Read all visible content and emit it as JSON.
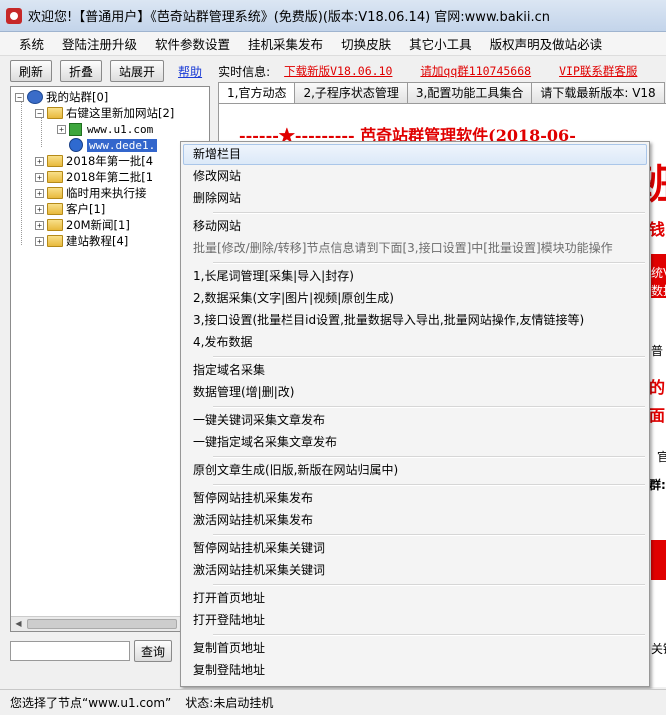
{
  "window": {
    "title": "欢迎您!【普通用户】《芭奇站群管理系统》(免费版)(版本:V18.06.14) 官网:www.bakii.cn"
  },
  "menubar": {
    "items": [
      "系统",
      "登陆注册升级",
      "软件参数设置",
      "挂机采集发布",
      "切换皮肤",
      "其它小工具",
      "版权声明及做站必读"
    ]
  },
  "toolbar": {
    "refresh_label": "刷新",
    "collapse_label": "折叠",
    "expand_label": "站展开",
    "help_label": "帮助",
    "realtime_label": "实时信息:",
    "download_link": "下载新版V18.06.10",
    "qq_link": "请加qq群110745668",
    "vip_link": "VIP联系群客服"
  },
  "tree": {
    "root_label": "我的站群[0]",
    "group_label": "右键这里新加网站[2]",
    "site1_label": "www.u1.com",
    "site2_label": "www.dede1.",
    "batch1_label": "2018年第一批[4",
    "batch2_label": "2018年第二批[1",
    "temp_label": "临时用来执行接",
    "client_label": "客户[1]",
    "news_label": "20M新闻[1]",
    "tutorial_label": "建站教程[4]"
  },
  "search": {
    "value": "",
    "query_label": "查询"
  },
  "tabs": [
    "1,官方动态",
    "2,子程序状态管理",
    "3,配置功能工具集合",
    "请下载最新版本: V18"
  ],
  "content": {
    "banner": "------★--------- 芭奇站群管理软件(2018-06-",
    "big_char": "班",
    "fragment_1": "钱,",
    "fragment_2": "统V",
    "fragment_3": "数据",
    "fragment_4": "普",
    "fragment_5": "的",
    "fragment_6": "面",
    "fragment_7": "官",
    "fragment_8": "群:",
    "fragment_9": "关键"
  },
  "context_menu": {
    "items": [
      {
        "label": "新增栏目",
        "state": "hover"
      },
      {
        "label": "修改网站",
        "state": "normal"
      },
      {
        "label": "删除网站",
        "state": "normal"
      },
      {
        "label": "移动网站",
        "state": "normal"
      },
      {
        "label": "批量[修改/删除/转移]节点信息请到下面[3,接口设置]中[批量设置]模块功能操作",
        "state": "disabled"
      },
      {
        "label": "1,长尾词管理[采集|导入|封存)",
        "state": "normal"
      },
      {
        "label": "2,数据采集(文字|图片|视频|原创生成)",
        "state": "normal"
      },
      {
        "label": "3,接口设置(批量栏目id设置,批量数据导入导出,批量网站操作,友情链接等)",
        "state": "normal"
      },
      {
        "label": "4,发布数据",
        "state": "normal"
      },
      {
        "label": "指定域名采集",
        "state": "normal"
      },
      {
        "label": "数据管理(增|删|改)",
        "state": "normal"
      },
      {
        "label": "一键关键词采集文章发布",
        "state": "normal"
      },
      {
        "label": "一键指定域名采集文章发布",
        "state": "normal"
      },
      {
        "label": "原创文章生成(旧版,新版在网站归属中)",
        "state": "normal"
      },
      {
        "label": "暂停网站挂机采集发布",
        "state": "normal"
      },
      {
        "label": "激活网站挂机采集发布",
        "state": "normal"
      },
      {
        "label": "暂停网站挂机采集关键词",
        "state": "normal"
      },
      {
        "label": "激活网站挂机采集关键词",
        "state": "normal"
      },
      {
        "label": "打开首页地址",
        "state": "normal"
      },
      {
        "label": "打开登陆地址",
        "state": "normal"
      },
      {
        "label": "复制首页地址",
        "state": "normal"
      },
      {
        "label": "复制登陆地址",
        "state": "normal"
      }
    ]
  },
  "statusbar": {
    "selected_node": "您选择了节点“www.u1.com”",
    "status": "状态:未启动挂机"
  },
  "colors": {
    "accent_red": "#e00000",
    "link_blue": "#1a3bd6",
    "selection_blue": "#3366cc"
  }
}
